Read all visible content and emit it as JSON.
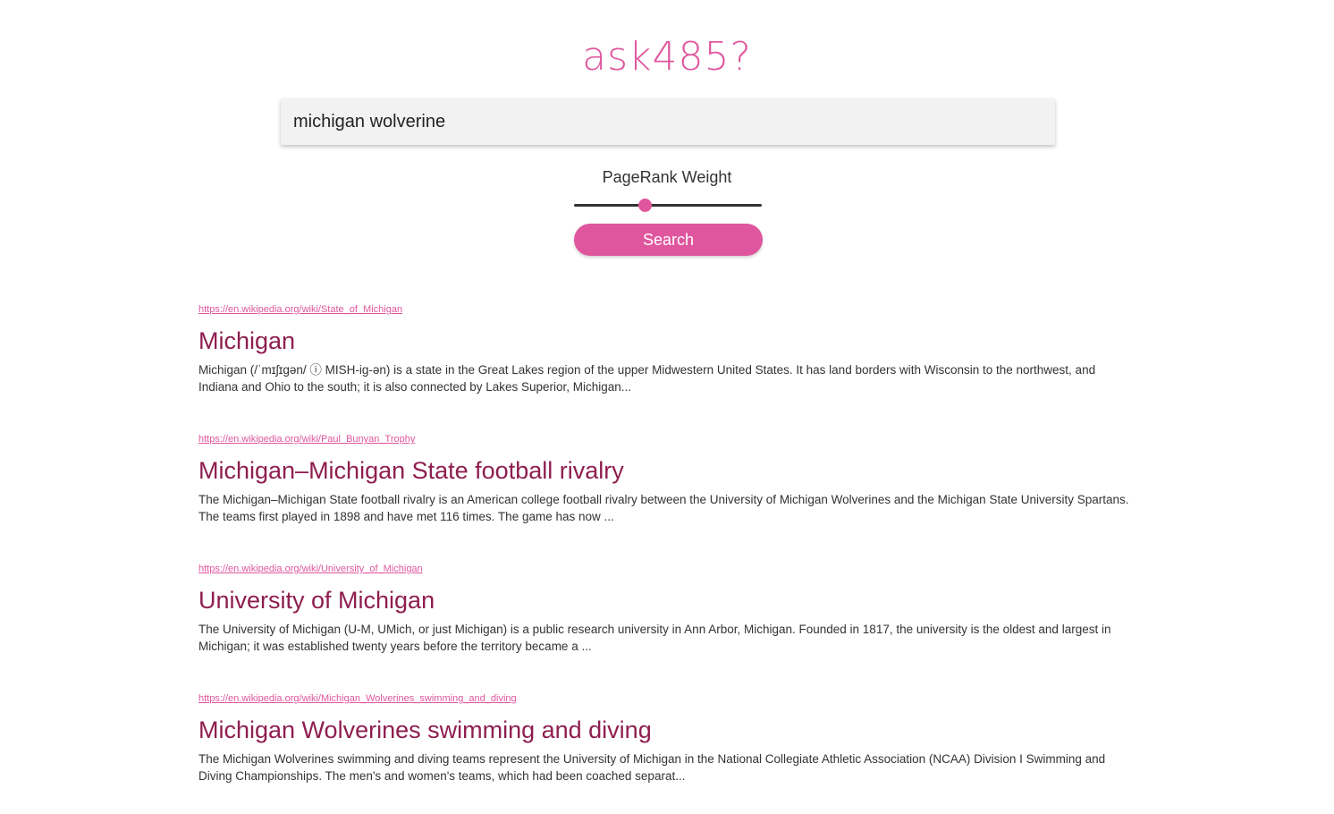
{
  "logo": {
    "text": "ask485?"
  },
  "search": {
    "value": "michigan wolverine"
  },
  "slider": {
    "label": "PageRank Weight",
    "value": 0.38
  },
  "search_button": {
    "label": "Search"
  },
  "colors": {
    "accent": "#e0569e",
    "title": "#8e1e4f"
  },
  "results": [
    {
      "url": "https://en.wikipedia.org/wiki/State_of_Michigan",
      "title": "Michigan",
      "snippet": "Michigan (/ˈmɪʃɪɡən/ ⓘ MISH-ig-ən) is a state in the Great Lakes region of the upper Midwestern United States. It has land borders with Wisconsin to the northwest, and Indiana and Ohio to the south; it is also connected by Lakes Superior, Michigan..."
    },
    {
      "url": "https://en.wikipedia.org/wiki/Paul_Bunyan_Trophy",
      "title": "Michigan–Michigan State football rivalry",
      "snippet": "The Michigan–Michigan State football rivalry is an American college football rivalry between the University of Michigan Wolverines and the Michigan State University Spartans. The teams first played in 1898 and have met 116 times. The game has now ..."
    },
    {
      "url": "https://en.wikipedia.org/wiki/University_of_Michigan",
      "title": "University of Michigan",
      "snippet": "The University of Michigan (U-M, UMich, or just Michigan) is a public research university in Ann Arbor, Michigan. Founded in 1817, the university is the oldest and largest in Michigan; it was established twenty years before the territory became a ..."
    },
    {
      "url": "https://en.wikipedia.org/wiki/Michigan_Wolverines_swimming_and_diving",
      "title": "Michigan Wolverines swimming and diving",
      "snippet": "The Michigan Wolverines swimming and diving teams represent the University of Michigan in the National Collegiate Athletic Association (NCAA) Division I Swimming and Diving Championships. The men's and women's teams, which had been coached separat..."
    }
  ]
}
